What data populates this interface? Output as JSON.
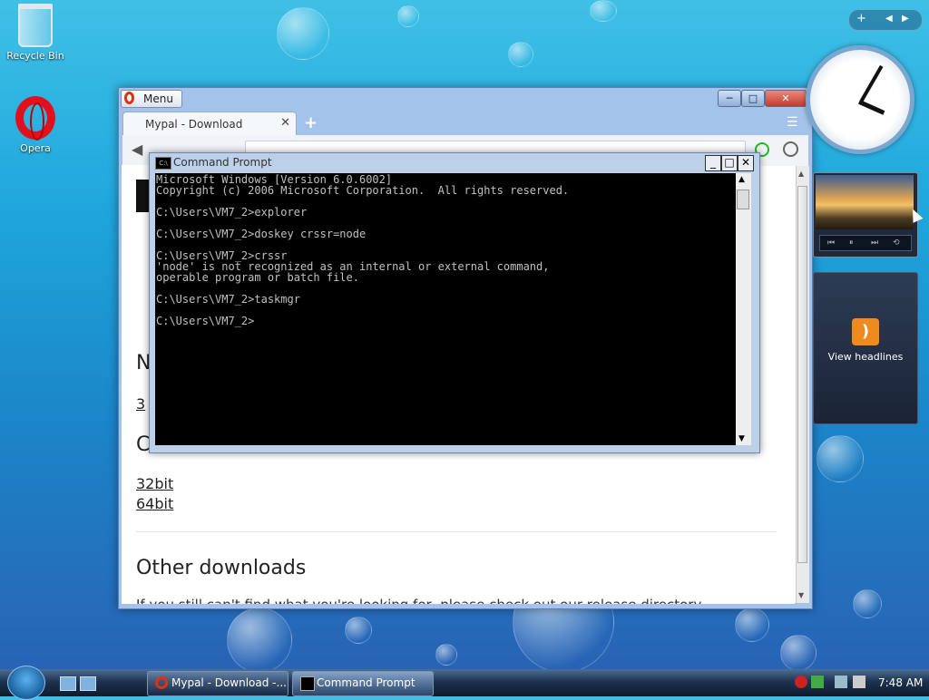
{
  "desktop": {
    "icons": [
      {
        "label": "Recycle Bin"
      },
      {
        "label": "Opera"
      }
    ]
  },
  "browser": {
    "menu_label": "Menu",
    "tab_title": "Mypal - Download",
    "new_tab": "+",
    "page": {
      "heading_partial_1": "N",
      "link_partial": "3",
      "heading_partial_2": "C",
      "links": [
        "32bit",
        "64bit"
      ],
      "other_heading": "Other downloads",
      "trailing_text": "If you still can't find what you're looking for, please check out our release directory."
    }
  },
  "cmd": {
    "title": "Command Prompt",
    "icon_text": "C:\\",
    "lines": [
      "Microsoft Windows [Version 6.0.6002]",
      "Copyright (c) 2006 Microsoft Corporation.  All rights reserved.",
      "",
      "C:\\Users\\VM7_2>explorer",
      "",
      "C:\\Users\\VM7_2>doskey crssr=node",
      "",
      "C:\\Users\\VM7_2>crssr",
      "'node' is not recognized as an internal or external command,",
      "operable program or batch file.",
      "",
      "C:\\Users\\VM7_2>taskmgr",
      "",
      "C:\\Users\\VM7_2>"
    ]
  },
  "gadgets": {
    "feed_label": "View headlines"
  },
  "taskbar": {
    "buttons": [
      {
        "label": "Mypal - Download -..."
      },
      {
        "label": "Command Prompt"
      }
    ],
    "time": "7:48 AM"
  }
}
